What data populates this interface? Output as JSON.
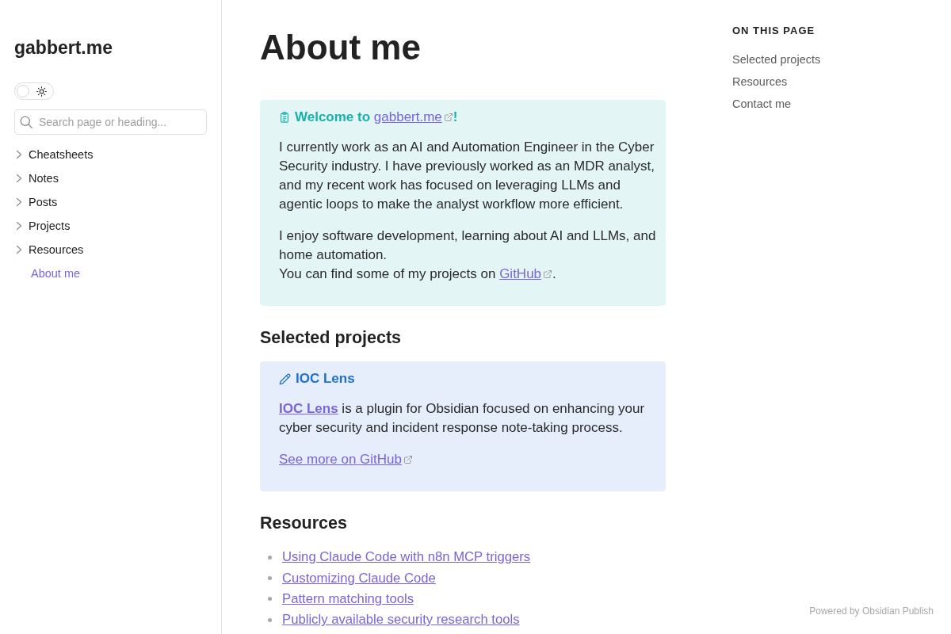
{
  "sidebar": {
    "site_title": "gabbert.me",
    "theme_toggle": {
      "on": false
    },
    "search": {
      "placeholder": "Search page or heading..."
    },
    "nav": [
      {
        "kind": "folder",
        "label": "Cheatsheets",
        "expanded": false,
        "selected": false
      },
      {
        "kind": "folder",
        "label": "Notes",
        "expanded": false,
        "selected": false
      },
      {
        "kind": "folder",
        "label": "Posts",
        "expanded": false,
        "selected": false
      },
      {
        "kind": "folder",
        "label": "Projects",
        "expanded": false,
        "selected": false
      },
      {
        "kind": "folder",
        "label": "Resources",
        "expanded": false,
        "selected": false
      },
      {
        "kind": "page",
        "label": "About me",
        "selected": true
      }
    ]
  },
  "article": {
    "title": "About me",
    "intro_callout": {
      "kind": "abstract",
      "title": [
        {
          "kind": "text",
          "text": "Welcome to "
        },
        {
          "kind": "external_link",
          "text": "gabbert.me"
        },
        {
          "kind": "text",
          "text": "!"
        }
      ],
      "paragraphs": [
        {
          "lines": [
            [
              {
                "kind": "text",
                "text": "I currently work as an AI and Automation Engineer in the Cyber Security industry. I have previously worked as an MDR analyst, and my recent work has focused on leveraging LLMs and agentic loops to make the analyst workflow more efficient."
              }
            ]
          ]
        },
        {
          "lines": [
            [
              {
                "kind": "text",
                "text": "I enjoy software development, learning about AI and LLMs, and home automation."
              }
            ],
            [
              {
                "kind": "text",
                "text": "You can find some of my projects on "
              },
              {
                "kind": "external_link",
                "text": "GitHub"
              },
              {
                "kind": "text",
                "text": "."
              }
            ]
          ]
        }
      ]
    },
    "sections": [
      {
        "heading": "Selected projects",
        "callouts": [
          {
            "kind": "note",
            "title": [
              {
                "kind": "text",
                "text": "IOC Lens"
              }
            ],
            "paragraphs": [
              {
                "lines": [
                  [
                    {
                      "kind": "internal_link",
                      "text": "IOC Lens",
                      "bold": true
                    },
                    {
                      "kind": "text",
                      "text": " is a plugin for Obsidian focused on enhancing your cyber security and incident response note-taking process."
                    }
                  ]
                ]
              },
              {
                "lines": [
                  [
                    {
                      "kind": "external_link",
                      "text": "See more on GitHub"
                    }
                  ]
                ]
              }
            ]
          }
        ]
      },
      {
        "heading": "Resources",
        "links": [
          "Using Claude Code with n8n MCP triggers",
          "Customizing Claude Code",
          "Pattern matching tools",
          "Publicly available security research tools"
        ]
      }
    ]
  },
  "toc": {
    "heading": "ON THIS PAGE",
    "items": [
      "Selected projects",
      "Resources",
      "Contact me"
    ]
  },
  "footer": "Powered by Obsidian Publish"
}
